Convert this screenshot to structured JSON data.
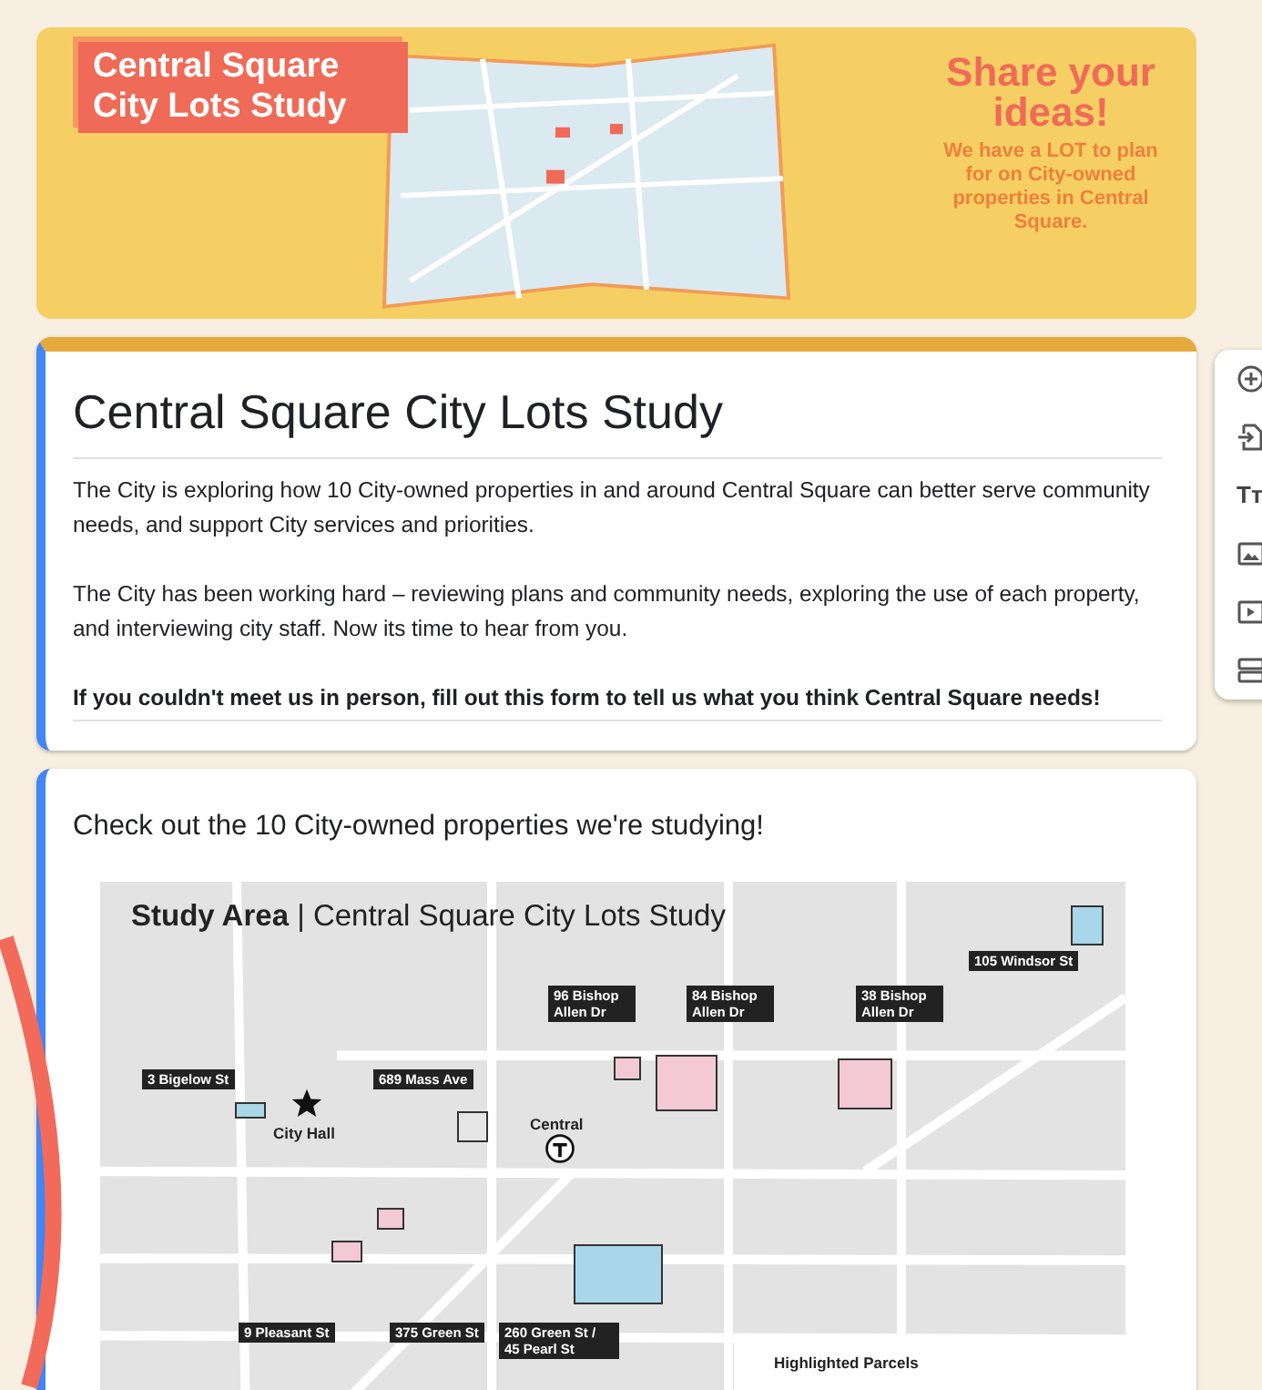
{
  "banner": {
    "title": "Central Square City Lots Study",
    "headline": "Share your ideas!",
    "tagline": "We have a LOT to plan for on City-owned properties in Central Square."
  },
  "form": {
    "title": "Central Square City Lots Study",
    "description": [
      {
        "text": "The City is exploring how 10 City-owned properties in and around Central  Square can better serve community needs, and support City services and priorities.",
        "bold": false
      },
      {
        "text": "The City has been working hard – reviewing plans and community needs, exploring the use of each property, and interviewing city staff. Now its time to hear from you.",
        "bold": false
      },
      {
        "text": "If you couldn't meet us in person, fill out this form to tell us what you think Central Square needs!",
        "bold": true
      }
    ]
  },
  "toolbar": [
    {
      "kind": "add"
    },
    {
      "kind": "import"
    },
    {
      "kind": "title",
      "glyph": "Tт"
    },
    {
      "kind": "image"
    },
    {
      "kind": "video"
    },
    {
      "kind": "section"
    }
  ],
  "question": {
    "title": "Check out the 10 City-owned properties we're studying!",
    "map": {
      "title": "**Study Area** | Central Square City Lots Study",
      "city_hall": "City Hall",
      "station": "Central",
      "legend_title": "Highlighted Parcels",
      "parcels": [
        {
          "label": "105 Windsor St",
          "color": "#a9d6e8"
        },
        {
          "label": "96 Bishop Allen Dr",
          "color": "#f3c9d6"
        },
        {
          "label": "84 Bishop Allen Dr",
          "color": "#f3c9d6"
        },
        {
          "label": "38 Bishop Allen Dr",
          "color": "#f3c9d6"
        },
        {
          "label": "3 Bigelow St",
          "color": "#a9d6e8"
        },
        {
          "label": "689 Mass Ave",
          "color": "#e6e6e6"
        },
        {
          "label": "9 Pleasant St",
          "color": "#f3c9d6"
        },
        {
          "label": "375 Green St",
          "color": "#f3c9d6"
        },
        {
          "label": "260 Green St / 45 Pearl St",
          "color": "#a9d6e8"
        }
      ]
    }
  }
}
